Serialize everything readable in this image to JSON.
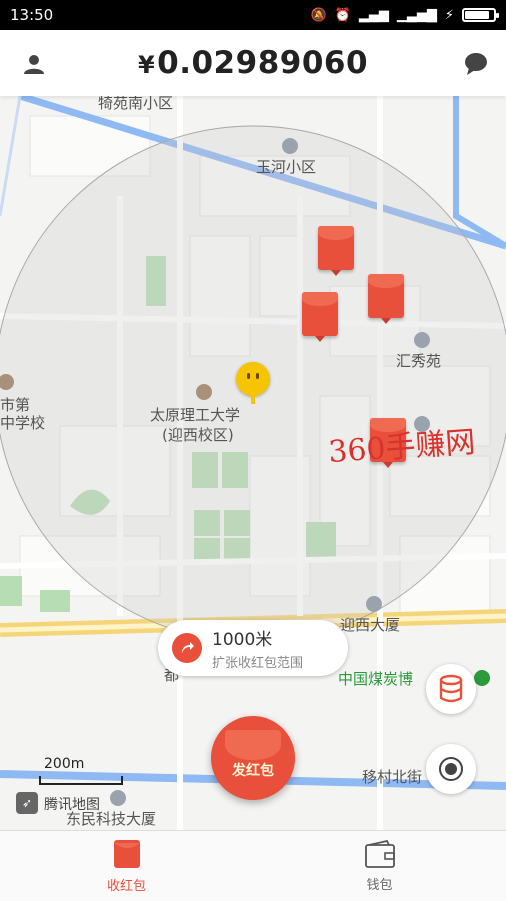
{
  "status_bar": {
    "time": "13:50",
    "battery_level": 0.85
  },
  "header": {
    "currency": "¥",
    "balance": "0.02989060"
  },
  "map": {
    "labels": {
      "north_community": "犄苑南小区",
      "yuhe": "玉河小区",
      "huixiu": "汇秀苑",
      "school_left_1": "市第",
      "school_left_2": "中学校",
      "university_1": "太原理工大学",
      "university_2": "(迎西校区)",
      "yingxi_building": "迎西大厦",
      "coal_museum": "中国煤炭博",
      "street_left": "东民科技大厦",
      "street_right": "移村北街",
      "partial_left": "都"
    },
    "watermark": "360手赚网",
    "scale_label": "200m",
    "provider": "腾讯地图"
  },
  "tooltip": {
    "distance": "1000米",
    "action": "扩张收红包范围"
  },
  "send_button_label": "发红包",
  "tabs": [
    {
      "label": "收红包"
    },
    {
      "label": "钱包"
    }
  ],
  "colors": {
    "accent": "#e8503b",
    "road_blue": "#8fb9f2",
    "road_yellow": "#f5d57a",
    "park_green": "#b7ddb4"
  },
  "icons": [
    "user-icon",
    "chat-icon",
    "location-arrow-icon",
    "coin-stack-icon",
    "locate-icon",
    "envelope-icon",
    "wallet-icon",
    "compass-icon",
    "school-icon",
    "community-icon"
  ]
}
